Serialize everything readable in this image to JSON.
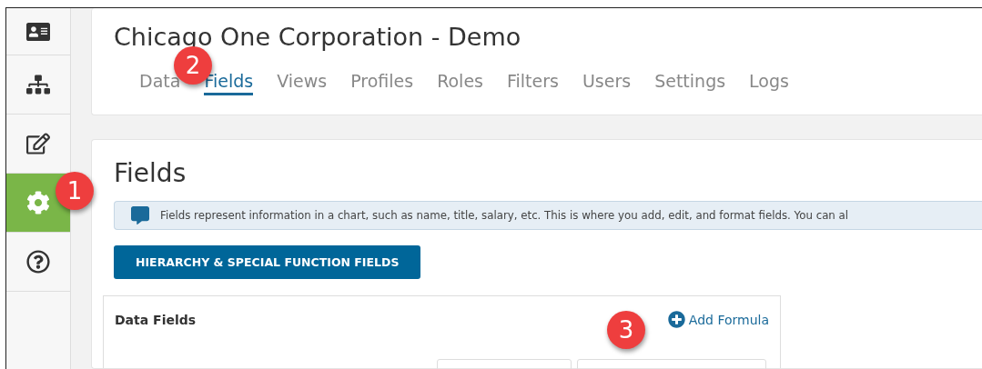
{
  "sidebar": {
    "items": [
      {
        "kind": "contact",
        "selected": false
      },
      {
        "kind": "hierarchy",
        "selected": false
      },
      {
        "kind": "edit",
        "selected": false
      },
      {
        "kind": "settings",
        "selected": true
      },
      {
        "kind": "help",
        "selected": false
      }
    ]
  },
  "header": {
    "title": "Chicago One Corporation - Demo",
    "tabs": [
      {
        "label": "Data",
        "selected": false
      },
      {
        "label": "Fields",
        "selected": true
      },
      {
        "label": "Views",
        "selected": false
      },
      {
        "label": "Profiles",
        "selected": false
      },
      {
        "label": "Roles",
        "selected": false
      },
      {
        "label": "Filters",
        "selected": false
      },
      {
        "label": "Users",
        "selected": false
      },
      {
        "label": "Settings",
        "selected": false
      },
      {
        "label": "Logs",
        "selected": false
      }
    ]
  },
  "page": {
    "heading": "Fields",
    "info": "Fields represent information in a chart, such as name, title, salary, etc. This is where you add, edit, and format fields. You can al",
    "button": "HIERARCHY & SPECIAL FUNCTION FIELDS",
    "panel": {
      "title": "Data Fields",
      "action": "Add Formula"
    }
  },
  "callouts": [
    {
      "number": "1"
    },
    {
      "number": "2"
    },
    {
      "number": "3"
    }
  ]
}
